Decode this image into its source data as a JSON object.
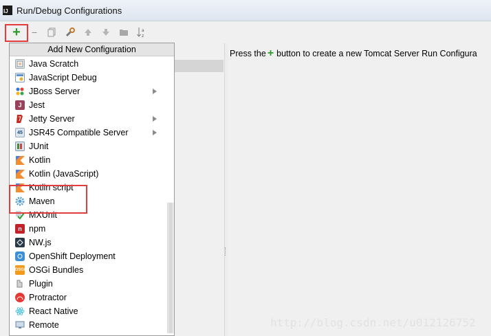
{
  "window": {
    "title": "Run/Debug Configurations",
    "app_icon_text": "IJ"
  },
  "toolbar": {
    "add": "+",
    "remove": "−",
    "copy": "⧉",
    "edit": "🔧",
    "up": "▲",
    "down": "▼",
    "folder": "▇",
    "sort": "↓ᵃ"
  },
  "popup": {
    "header": "Add New Configuration",
    "items": [
      {
        "label": "Java Scratch",
        "icon": "java-scratch-icon",
        "submenu": false
      },
      {
        "label": "JavaScript Debug",
        "icon": "javascript-debug-icon",
        "submenu": false
      },
      {
        "label": "JBoss Server",
        "icon": "jboss-icon",
        "submenu": true
      },
      {
        "label": "Jest",
        "icon": "jest-icon",
        "submenu": false
      },
      {
        "label": "Jetty Server",
        "icon": "jetty-icon",
        "submenu": true
      },
      {
        "label": "JSR45 Compatible Server",
        "icon": "jsr45-icon",
        "submenu": true
      },
      {
        "label": "JUnit",
        "icon": "junit-icon",
        "submenu": false
      },
      {
        "label": "Kotlin",
        "icon": "kotlin-icon",
        "submenu": false
      },
      {
        "label": "Kotlin (JavaScript)",
        "icon": "kotlin-js-icon",
        "submenu": false
      },
      {
        "label": "Kotlin script",
        "icon": "kotlin-script-icon",
        "submenu": false
      },
      {
        "label": "Maven",
        "icon": "maven-gear-icon",
        "submenu": false
      },
      {
        "label": "MXUnit",
        "icon": "mxunit-icon",
        "submenu": false
      },
      {
        "label": "npm",
        "icon": "npm-icon",
        "submenu": false
      },
      {
        "label": "NW.js",
        "icon": "nwjs-icon",
        "submenu": false
      },
      {
        "label": "OpenShift Deployment",
        "icon": "openshift-icon",
        "submenu": false
      },
      {
        "label": "OSGi Bundles",
        "icon": "osgi-icon",
        "submenu": false
      },
      {
        "label": "Plugin",
        "icon": "plugin-icon",
        "submenu": false
      },
      {
        "label": "Protractor",
        "icon": "protractor-icon",
        "submenu": false
      },
      {
        "label": "React Native",
        "icon": "react-icon",
        "submenu": false
      },
      {
        "label": "Remote",
        "icon": "remote-icon",
        "submenu": false
      }
    ]
  },
  "hint": {
    "before": "Press the",
    "plus": "+",
    "after": "button to create a new Tomcat Server Run Configura"
  },
  "watermark": "http://blog.csdn.net/u012126752"
}
